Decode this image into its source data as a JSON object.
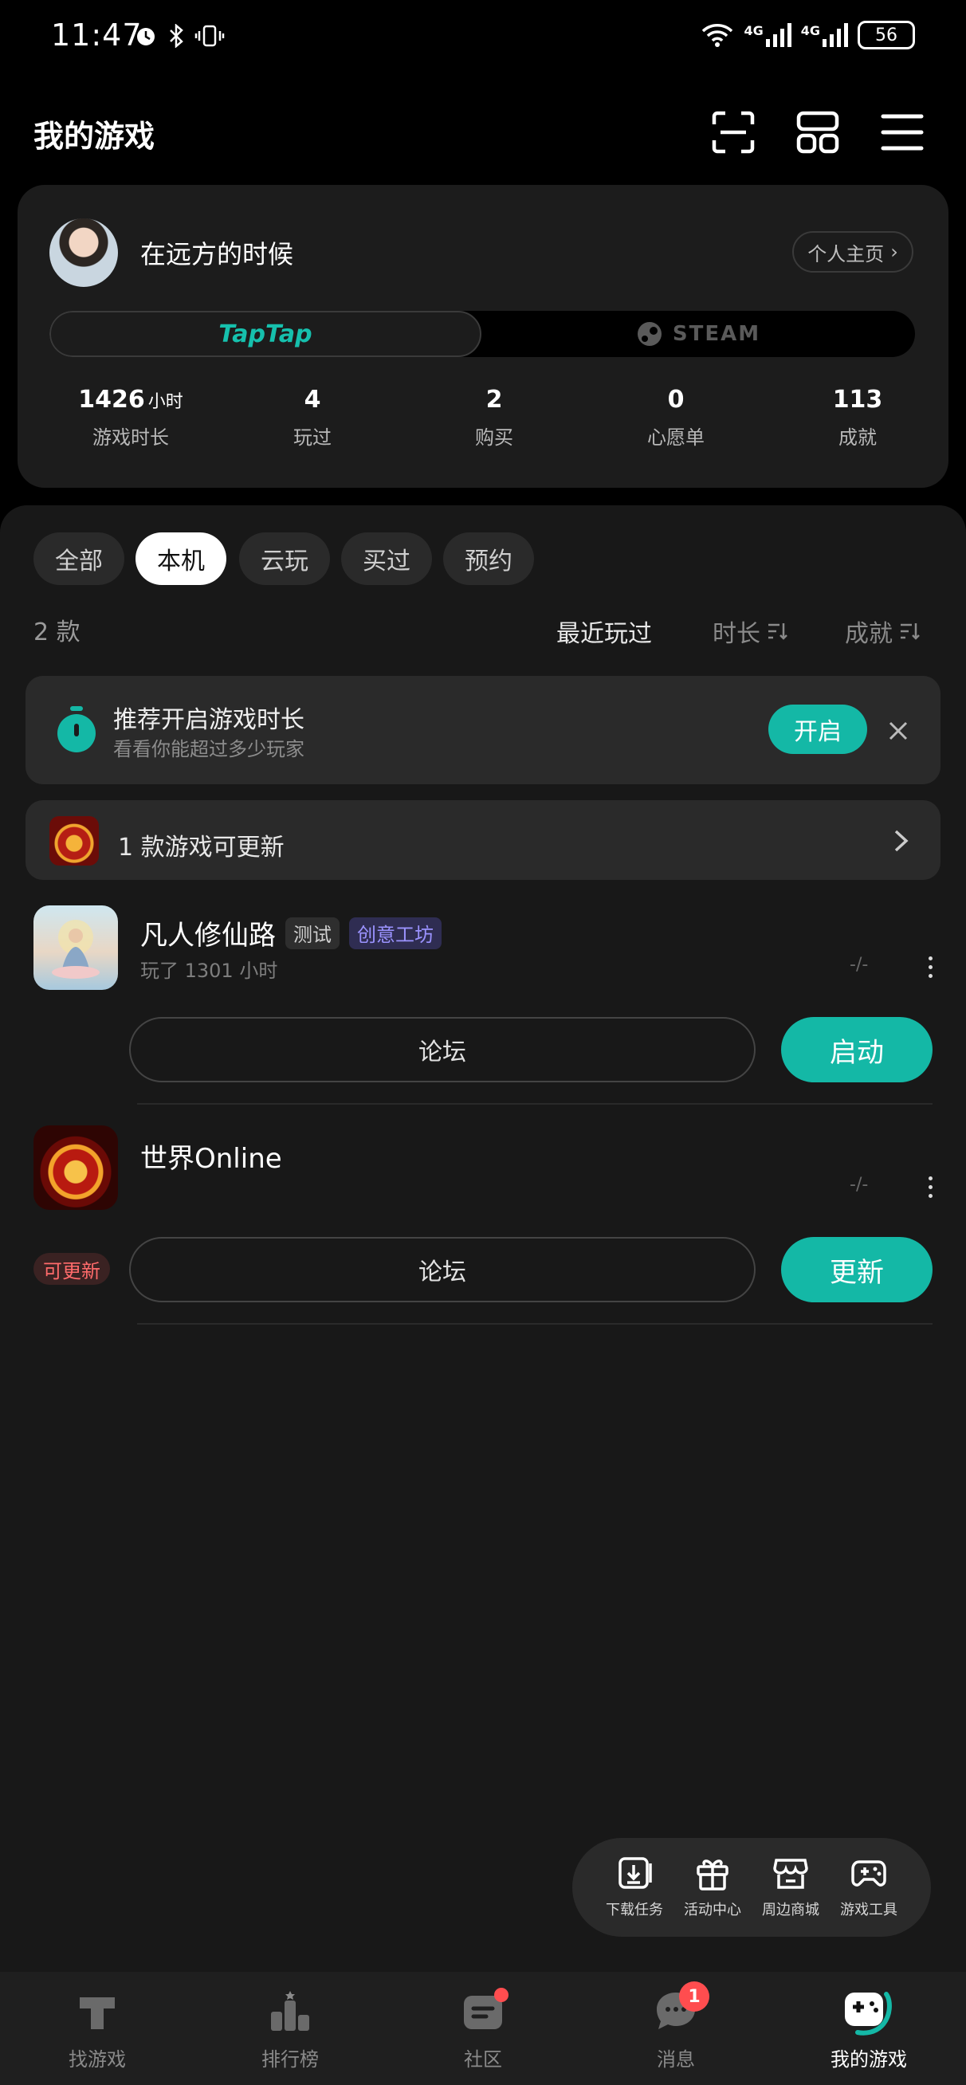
{
  "status_bar": {
    "time": "11:47",
    "net1": "4G",
    "net2": "4G",
    "battery": "56"
  },
  "header": {
    "title": "我的游戏"
  },
  "profile": {
    "username": "在远方的时候",
    "homepage_button": "个人主页",
    "platform_tabs": [
      "TapTap",
      "STEAM"
    ],
    "stats": [
      {
        "value": "1426",
        "unit": "小时",
        "label": "游戏时长"
      },
      {
        "value": "4",
        "unit": "",
        "label": "玩过"
      },
      {
        "value": "2",
        "unit": "",
        "label": "购买"
      },
      {
        "value": "0",
        "unit": "",
        "label": "心愿单"
      },
      {
        "value": "113",
        "unit": "",
        "label": "成就"
      }
    ]
  },
  "filters": {
    "chips": [
      "全部",
      "本机",
      "云玩",
      "买过",
      "预约"
    ],
    "active_chip": "本机",
    "count_label": "2 款",
    "sort": [
      "最近玩过",
      "时长",
      "成就"
    ],
    "active_sort": "最近玩过"
  },
  "banner": {
    "title": "推荐开启游戏时长",
    "subtitle": "看看你能超过多少玩家",
    "enable_label": "开启"
  },
  "update_bar": {
    "text": "1 款游戏可更新"
  },
  "games": [
    {
      "name": "凡人修仙路",
      "tags": [
        "测试",
        "创意工坊"
      ],
      "meta": "玩了 1301 小时",
      "rating": "-/-",
      "forum_label": "论坛",
      "action_label": "启动"
    },
    {
      "name": "世界Online",
      "tags": [],
      "meta": "",
      "rating": "-/-",
      "badge": "可更新",
      "forum_label": "论坛",
      "action_label": "更新"
    }
  ],
  "tools": [
    {
      "icon": "download-task-icon",
      "label": "下载任务"
    },
    {
      "icon": "gift-icon",
      "label": "活动中心"
    },
    {
      "icon": "store-icon",
      "label": "周边商城"
    },
    {
      "icon": "gamepad-icon",
      "label": "游戏工具"
    }
  ],
  "bottom_nav": {
    "items": [
      {
        "label": "找游戏",
        "icon": "taptap-logo-icon"
      },
      {
        "label": "排行榜",
        "icon": "ranking-icon"
      },
      {
        "label": "社区",
        "icon": "community-icon"
      },
      {
        "label": "消息",
        "icon": "message-icon",
        "badge": "1"
      },
      {
        "label": "我的游戏",
        "icon": "my-games-icon"
      }
    ],
    "active": "我的游戏"
  },
  "colors": {
    "accent": "#14b8a6",
    "badge_red": "#ff4d4f",
    "workshop_purple": "#9b93ff"
  }
}
